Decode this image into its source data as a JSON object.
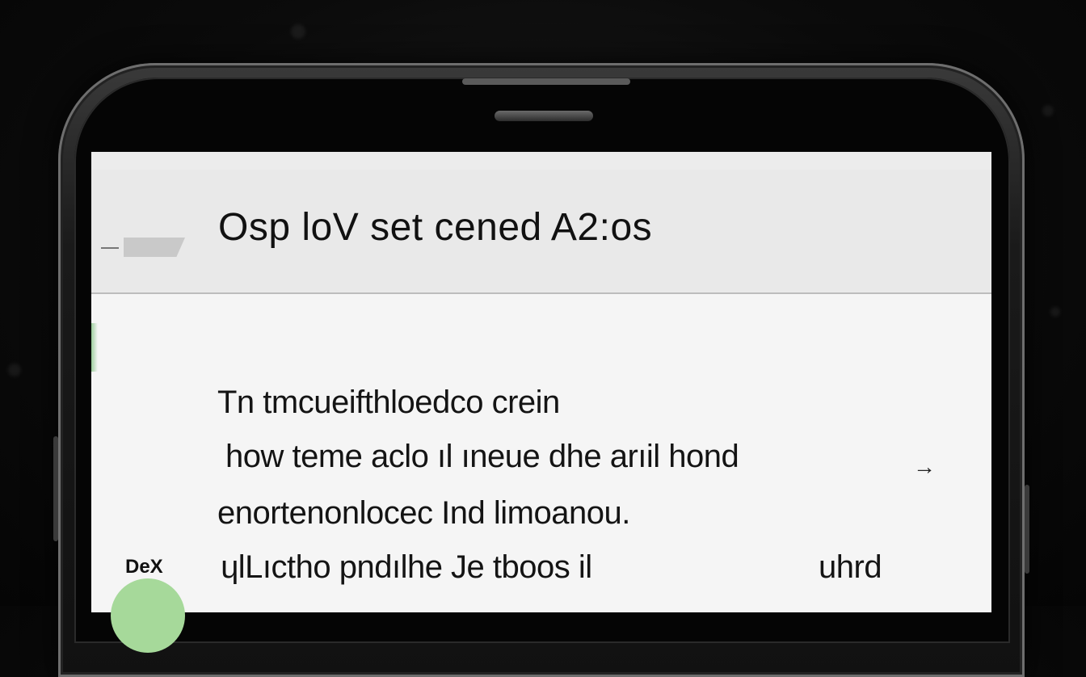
{
  "app": {
    "title": "Osp loV set cened A2:os"
  },
  "content": {
    "lines": [
      "Tn tmcueifthloedco crein",
      "how teme aclo ıl ıneue dhe arıil hond",
      "enortenonlocec Ind limoanou.",
      "ɥlLıctho pndılhe Je tboos il",
      "uhrd"
    ]
  },
  "overlay": {
    "dex_label": "DeX"
  },
  "icons": {
    "back": "back-arrow-icon",
    "arrow": "arrow-right-icon"
  },
  "colors": {
    "screen_bg": "#f4f4f4",
    "appbar_bg": "#e9e9e9",
    "badge_green": "#a6d99a"
  }
}
